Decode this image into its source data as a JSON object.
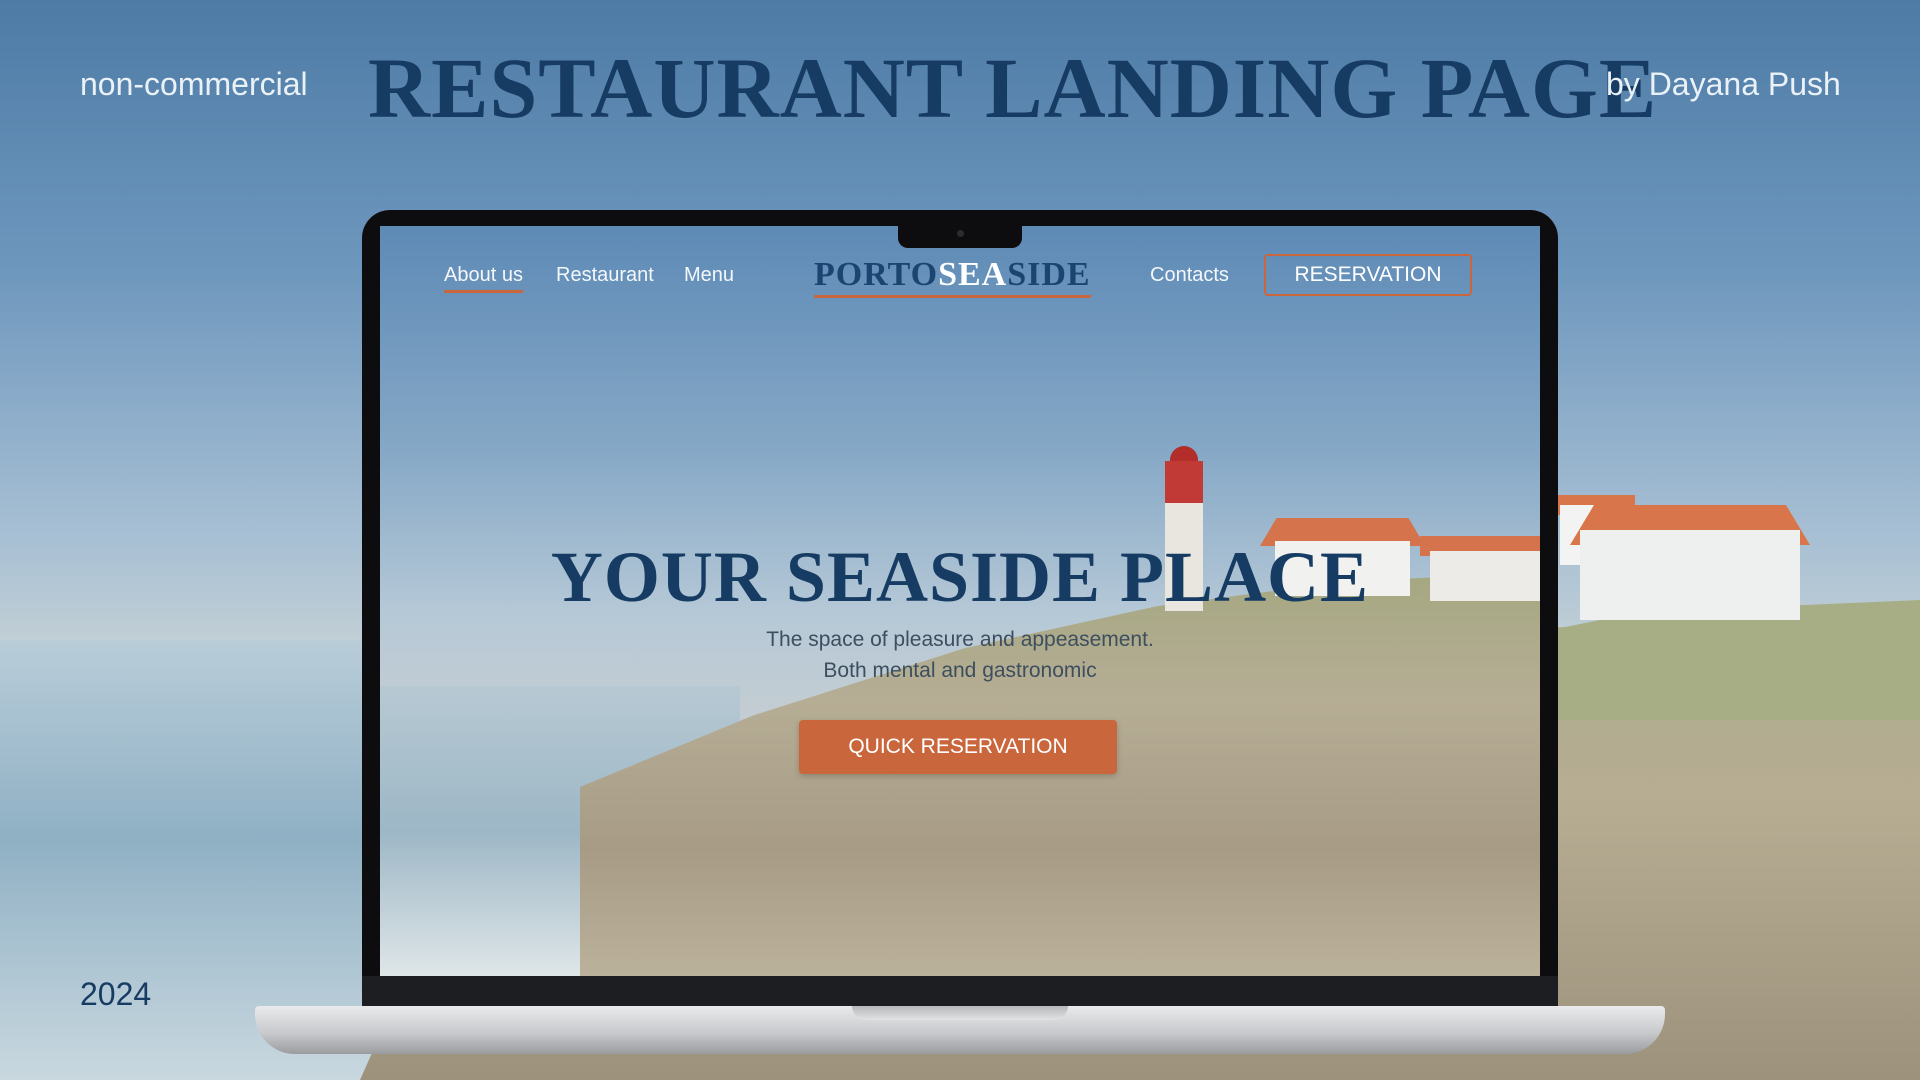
{
  "slide": {
    "left_note": "non-commercial",
    "title": "RESTAURANT LANDING PAGE",
    "author": "by Dayana Push",
    "year": "2024"
  },
  "site": {
    "nav": {
      "links": [
        "About us",
        "Restaurant",
        "Menu",
        "Contacts"
      ],
      "active_link": "About us",
      "logo_part1": "PORTO",
      "logo_part2": "SEA",
      "logo_part3": "SIDE",
      "reservation_button": "RESERVATION"
    },
    "hero": {
      "title": "YOUR SEASIDE PLACE",
      "subtitle_line1": "The space of pleasure and appeasement.",
      "subtitle_line2": "Both mental and gastronomic",
      "cta_button": "QUICK RESERVATION"
    },
    "colors": {
      "brand_navy": "#173c63",
      "accent_orange": "#c9663c"
    }
  }
}
